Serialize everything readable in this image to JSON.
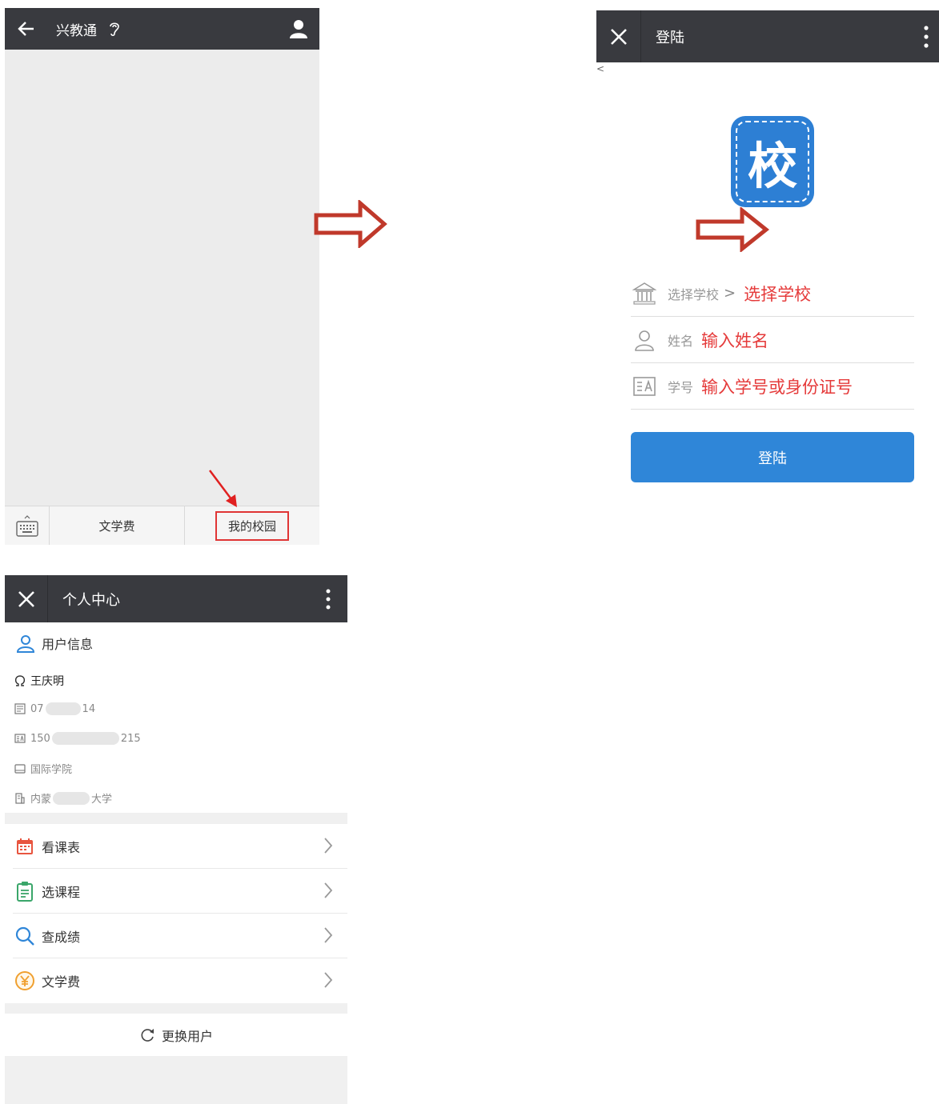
{
  "chat": {
    "title": "兴教通",
    "menu": [
      {
        "label": "文学费"
      },
      {
        "label": "我的校园"
      }
    ]
  },
  "login": {
    "title": "登陆",
    "corner_text": "<",
    "logo_char": "校",
    "rows": [
      {
        "label": "选择学校",
        "chevron": ">",
        "value": "选择学校"
      },
      {
        "label": "姓名",
        "value": "输入姓名"
      },
      {
        "label": "学号",
        "value": "输入学号或身份证号"
      }
    ],
    "button": "登陆"
  },
  "profile": {
    "title": "个人中心",
    "info_header": "用户信息",
    "name": "王庆明",
    "phone_prefix": "07",
    "phone_suffix": "14",
    "id_prefix": "150",
    "id_suffix": "215",
    "college": "国际学院",
    "university_prefix": "内蒙",
    "university_suffix": "大学",
    "menu": [
      {
        "label": "看课表"
      },
      {
        "label": "选课程"
      },
      {
        "label": "查成绩"
      },
      {
        "label": "文学费"
      }
    ],
    "switch_user": "更换用户"
  },
  "colors": {
    "titlebar": "#393a3f",
    "accent_blue": "#2f86d8",
    "annotation_red": "#c0392b",
    "placeholder_red": "#e53a3a"
  }
}
